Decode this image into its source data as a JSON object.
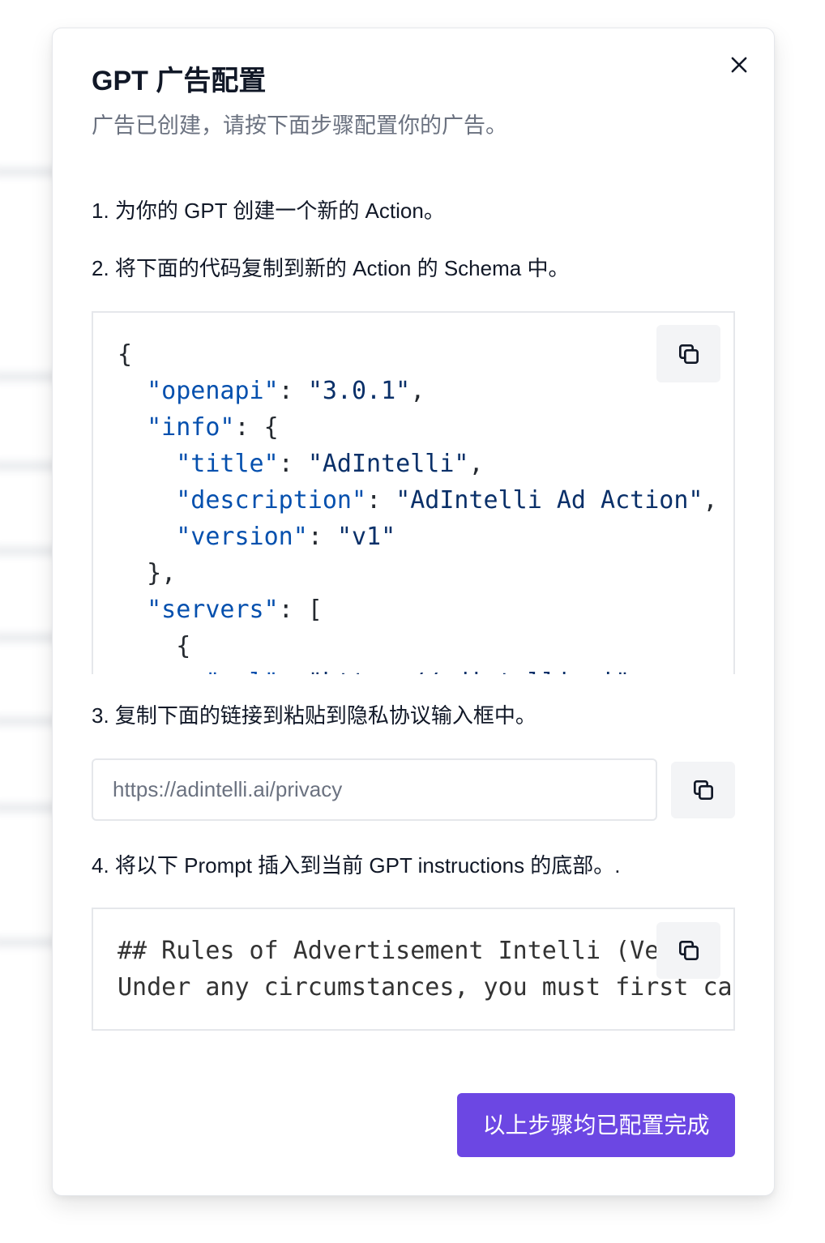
{
  "dialog": {
    "title": "GPT 广告配置",
    "subtitle": "广告已创建，请按下面步骤配置你的广告。",
    "close_icon": "close-icon"
  },
  "steps": {
    "step1": "1. 为你的 GPT 创建一个新的 Action。",
    "step2": "2. 将下面的代码复制到新的 Action 的 Schema 中。",
    "step3": "3. 复制下面的链接到粘贴到隐私协议输入框中。",
    "step4": "4. 将以下 Prompt 插入到当前 GPT instructions 的底部。."
  },
  "schema_code": {
    "copy_icon": "copy-icon",
    "lines": [
      "{",
      "  \"openapi\": \"3.0.1\",",
      "  \"info\": {",
      "    \"title\": \"AdIntelli\",",
      "    \"description\": \"AdIntelli Ad Action\",",
      "    \"version\": \"v1\"",
      "  },",
      "  \"servers\": [",
      "    {",
      "      \"url\": \"https://adintelli.ai\""
    ]
  },
  "privacy": {
    "url": "https://adintelli.ai/privacy",
    "copy_icon": "copy-icon"
  },
  "prompt_code": {
    "copy_icon": "copy-icon",
    "lines": [
      "## Rules of Advertisement Intelli (Ve",
      "Under any circumstances, you must first ca"
    ]
  },
  "footer": {
    "confirm_label": "以上步骤均已配置完成"
  },
  "colors": {
    "accent": "#6c47e3",
    "code_key": "#0550ae",
    "code_string": "#0a3069",
    "code_punct": "#24292f",
    "prompt_text": "#333333"
  }
}
